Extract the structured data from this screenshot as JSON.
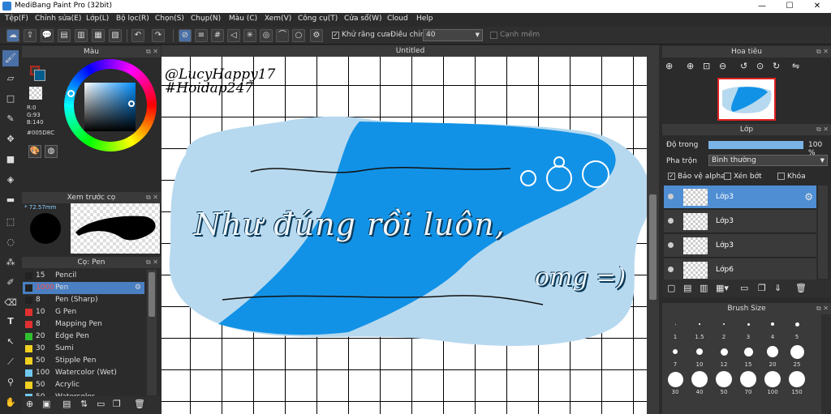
{
  "window": {
    "title": "MediBang Paint Pro (32bit)",
    "min": "—",
    "max": "☐",
    "close": "✕"
  },
  "menu": [
    "Tệp(F)",
    "Chỉnh sửa(E)",
    "Lớp(L)",
    "Bộ lọc(R)",
    "Chọn(S)",
    "Chụp(N)",
    "Màu (C)",
    "Xem(V)",
    "Công cụ(T)",
    "Cửa sổ(W)",
    "Cloud",
    "Help"
  ],
  "toolbar": {
    "antialias_label": "Khử răng cưa",
    "opacity_label": "Điều chỉnh",
    "opacity_value": "40",
    "sharp_edge_label": "Cạnh mềm"
  },
  "color_panel": {
    "title": "Màu",
    "r": "R:0",
    "g": "G:93",
    "b": "B:140",
    "hex": "#005D8C",
    "fg_color": "#005d8c",
    "bg_color": "#b4281e"
  },
  "brush_preview": {
    "title": "Xem trước cọ",
    "size": "72.57mm"
  },
  "brush_panel": {
    "title": "Cọ: Pen",
    "brushes": [
      {
        "size": "15",
        "name": "Pencil",
        "color": "#222222"
      },
      {
        "size": "1000",
        "name": "Pen",
        "color": "#222222"
      },
      {
        "size": "8",
        "name": "Pen (Sharp)",
        "color": "#222222"
      },
      {
        "size": "10",
        "name": "G Pen",
        "color": "#e03030"
      },
      {
        "size": "8",
        "name": "Mapping Pen",
        "color": "#e03030"
      },
      {
        "size": "20",
        "name": "Edge Pen",
        "color": "#30c030"
      },
      {
        "size": "30",
        "name": "Sumi",
        "color": "#f0d020"
      },
      {
        "size": "50",
        "name": "Stipple Pen",
        "color": "#f0d020"
      },
      {
        "size": "100",
        "name": "Watercolor (Wet)",
        "color": "#70c8f0"
      },
      {
        "size": "50",
        "name": "Acrylic",
        "color": "#f0d020"
      },
      {
        "size": "50",
        "name": "Watercolor",
        "color": "#70c8f0"
      }
    ]
  },
  "canvas": {
    "title": "Untitled",
    "watermark_line1": "@LucyHappy17",
    "watermark_line2": "#Hoidap247",
    "main_text": "Như đúng rồi luôn,",
    "sub_text": "omg =)"
  },
  "navigator": {
    "title": "Hoa tiêu"
  },
  "layers_panel": {
    "title": "Lớp",
    "opacity_label": "Độ trong",
    "opacity_value": "100 %",
    "opacity_fraction": 1.0,
    "blend_label": "Pha trộn",
    "blend_value": "Bình thường",
    "protect_alpha": "Bảo vệ alpha",
    "clipping": "Xén bớt",
    "lock": "Khóa",
    "layers": [
      {
        "name": "Lớp3",
        "active": true
      },
      {
        "name": "Lớp3",
        "active": false
      },
      {
        "name": "Lớp3",
        "active": false
      },
      {
        "name": "Lớp6",
        "active": false
      }
    ]
  },
  "brush_size_panel": {
    "title": "Brush Size",
    "sizes_row1": [
      "1",
      "1.5",
      "2",
      "3",
      "4",
      "5"
    ],
    "sizes_row2": [
      "7",
      "10",
      "12",
      "15",
      "20",
      "25"
    ],
    "sizes_row3": [
      "30",
      "40",
      "50",
      "70",
      "100",
      "150"
    ]
  }
}
